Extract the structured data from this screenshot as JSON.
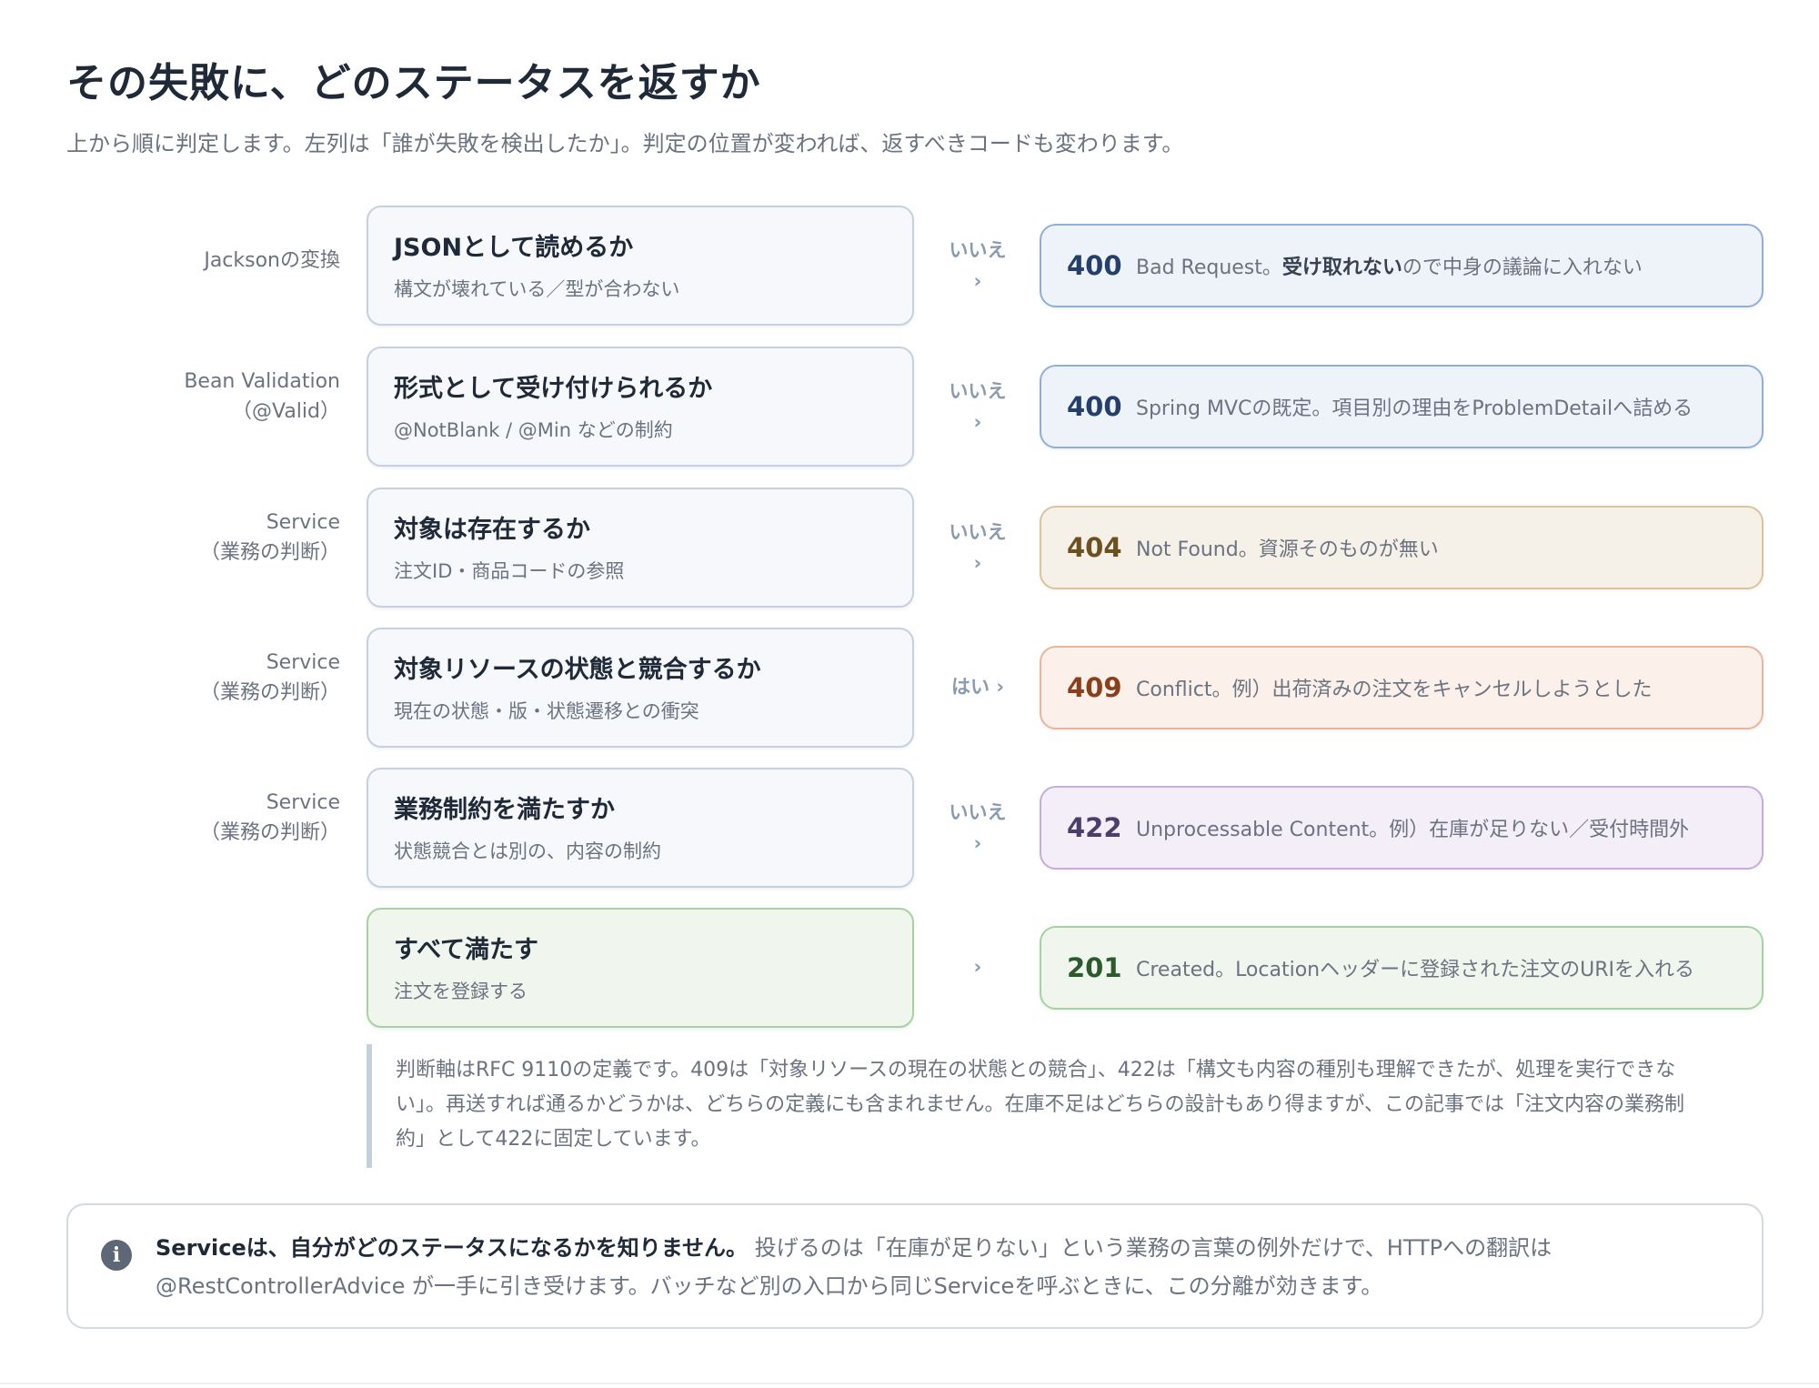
{
  "title": "その失敗に、どのステータスを返すか",
  "subtitle": "上から順に判定します。左列は「誰が失敗を検出したか」。判定の位置が変われば、返すべきコードも変わります。",
  "rows": [
    {
      "detector": [
        "Jacksonの変換"
      ],
      "question": "JSONとして読めるか",
      "question_sub": "構文が壊れている／型が合わない",
      "arrow": "いいえ",
      "chevron": "›",
      "code": "400",
      "result_bold": "",
      "result_pre": "Bad Request。",
      "result_emph": "受け取れない",
      "result_post": "ので中身の議論に入れない"
    },
    {
      "detector": [
        "Bean Validation",
        "（@Valid）"
      ],
      "question": "形式として受け付けられるか",
      "question_sub": "@NotBlank / @Min などの制約",
      "arrow": "いいえ",
      "chevron": "›",
      "code": "400",
      "result_pre": "Spring MVCの既定。項目別の理由をProblemDetailへ詰める",
      "result_emph": "",
      "result_post": ""
    },
    {
      "detector": [
        "Service",
        "（業務の判断）"
      ],
      "question": "対象は存在するか",
      "question_sub": "注文ID・商品コードの参照",
      "arrow": "いいえ",
      "chevron": "›",
      "code": "404",
      "result_pre": "Not Found。資源そのものが無い",
      "result_emph": "",
      "result_post": ""
    },
    {
      "detector": [
        "Service",
        "（業務の判断）"
      ],
      "question": "対象リソースの状態と競合するか",
      "question_sub": "現在の状態・版・状態遷移との衝突",
      "arrow": "はい ›",
      "chevron": "",
      "code": "409",
      "result_pre": "Conflict。例）出荷済みの注文をキャンセルしようとした",
      "result_emph": "",
      "result_post": ""
    },
    {
      "detector": [
        "Service",
        "（業務の判断）"
      ],
      "question": "業務制約を満たすか",
      "question_sub": "状態競合とは別の、内容の制約",
      "arrow": "いいえ",
      "chevron": "›",
      "code": "422",
      "result_pre": "Unprocessable Content。例）在庫が足りない／受付時間外",
      "result_emph": "",
      "result_post": ""
    },
    {
      "detector": [],
      "question": "すべて満たす",
      "question_sub": "注文を登録する",
      "arrow": "",
      "chevron": "›",
      "code": "201",
      "result_pre": "Created。Locationヘッダーに登録された注文のURIを入れる",
      "result_emph": "",
      "result_post": ""
    }
  ],
  "note": {
    "line1": "判断軸はRFC 9110の定義です。409は「対象リソースの現在の状態との競合」、422は「構文も内容の種別も理解できたが、処理を実行できな",
    "line2": "い」。再送すれば通るかどうかは、どちらの定義にも含まれません。在庫不足はどちらの設計もあり得ますが、この記事では「注文内容の業務制",
    "line3": "約」として422に固定しています。"
  },
  "info": {
    "icon": "info-icon",
    "bold": "Serviceは、自分がどのステータスになるかを知りません。",
    "text1": " 投げるのは「在庫が足りない」という業務の言葉の例外だけで、HTTPへの翻訳は",
    "text2": "@RestControllerAdvice が一手に引き受けます。バッチなど別の入口から同じServiceを呼ぶときに、この分離が効きます。"
  },
  "colors": {
    "code_400": "#24406a",
    "code_404": "#6e5020",
    "code_409": "#8a3f1c",
    "code_422": "#4b3f6a",
    "code_201": "#2c5a2c"
  }
}
